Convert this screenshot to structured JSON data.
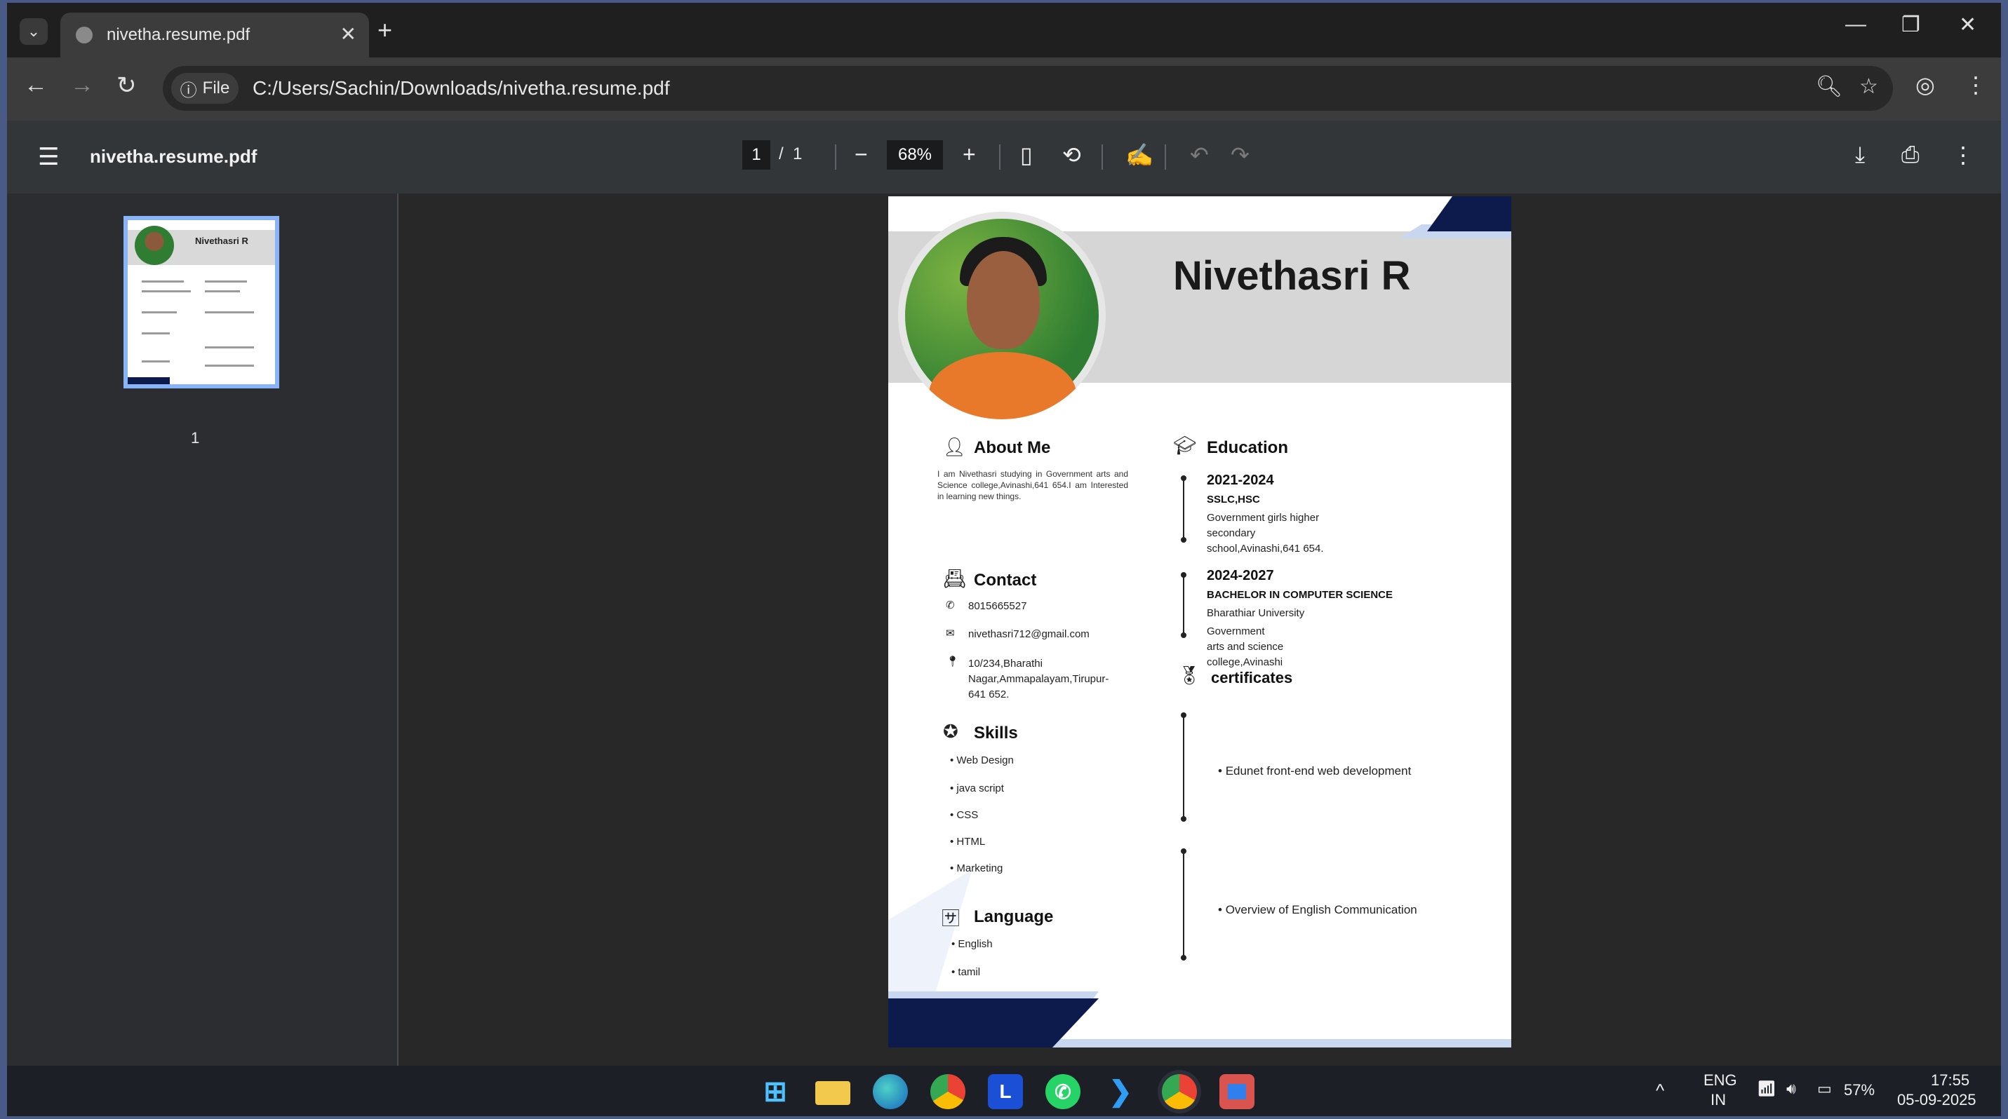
{
  "browser": {
    "tab_title": "nivetha.resume.pdf",
    "tab_close": "✕",
    "new_tab": "+",
    "tab_search_icon": "⌄",
    "window_controls": [
      "—",
      "❐",
      "✕"
    ],
    "chip_label": "File",
    "url": "C:/Users/Sachin/Downloads/nivetha.resume.pdf"
  },
  "pdf_toolbar": {
    "file_name": "nivetha.resume.pdf",
    "current_page": "1",
    "page_separator": "/",
    "total_pages": "1",
    "zoom": "68%"
  },
  "thumbnail": {
    "name": "Nivethasri R",
    "page_number": "1"
  },
  "resume": {
    "name": "Nivethasri R",
    "about": {
      "title": "About Me",
      "text": "I am Nivethasri studying in Government arts and Science college,Avinashi,641 654.I am Interested in learning new things."
    },
    "contact": {
      "title": "Contact",
      "phone": "8015665527",
      "email": "nivethasri712@gmail.com",
      "address_line1": "10/234,Bharathi",
      "address_line2": "Nagar,Ammapalayam,Tirupur-",
      "address_line3": "641 652."
    },
    "skills": {
      "title": "Skills",
      "items": [
        "Web Design",
        "java script",
        "CSS",
        "HTML",
        "Marketing"
      ]
    },
    "language": {
      "title": "Language",
      "items": [
        "English",
        "tamil"
      ]
    },
    "education": {
      "title": "Education",
      "entries": [
        {
          "years": "2021-2024",
          "degree": "SSLC,HSC",
          "line1": "Government girls higher",
          "line2": "secondary",
          "line3": "school,Avinashi,641 654."
        },
        {
          "years": "2024-2027",
          "degree": "BACHELOR IN COMPUTER SCIENCE",
          "line1": "Bharathiar University",
          "line2": "Government",
          "line3": "arts and science",
          "line4": "college,Avinashi"
        }
      ]
    },
    "certificates": {
      "title": "certificates",
      "items": [
        "Edunet front-end web development",
        "Overview of English Communication"
      ]
    }
  },
  "taskbar": {
    "language_line1": "ENG",
    "language_line2": "IN",
    "battery": "57%",
    "time": "17:55",
    "date": "05-09-2025",
    "l_app_letter": "L"
  },
  "colors": {
    "accent_navy": "#0d1b4c",
    "accent_light_blue": "#c8d7ef",
    "thumbnail_border": "#8ab4f8"
  }
}
